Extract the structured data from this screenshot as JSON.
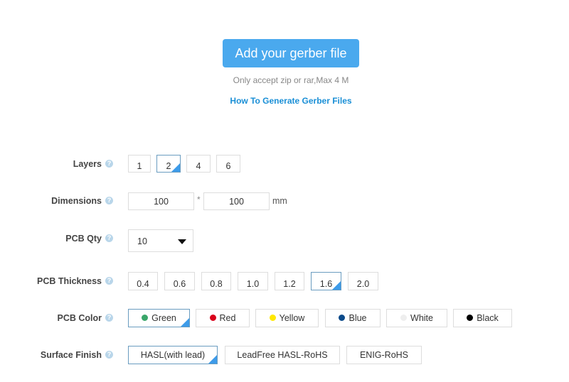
{
  "upload": {
    "button": "Add your gerber file",
    "note": "Only accept zip or rar,Max 4 M",
    "howto_link": "How To Generate Gerber Files"
  },
  "help_icon": "?",
  "layers": {
    "label": "Layers",
    "options": [
      "1",
      "2",
      "4",
      "6"
    ],
    "selected": "2"
  },
  "dimensions": {
    "label": "Dimensions",
    "width": "100",
    "height": "100",
    "separator": "*",
    "unit": "mm"
  },
  "qty": {
    "label": "PCB Qty",
    "value": "10"
  },
  "thickness": {
    "label": "PCB Thickness",
    "options": [
      "0.4",
      "0.6",
      "0.8",
      "1.0",
      "1.2",
      "1.6",
      "2.0"
    ],
    "selected": "1.6"
  },
  "color": {
    "label": "PCB Color",
    "options": [
      {
        "name": "Green",
        "hex": "#3aa66a"
      },
      {
        "name": "Red",
        "hex": "#d9001b"
      },
      {
        "name": "Yellow",
        "hex": "#ffe800"
      },
      {
        "name": "Blue",
        "hex": "#0b4a8a"
      },
      {
        "name": "White",
        "hex": "#eeeeee"
      },
      {
        "name": "Black",
        "hex": "#000000"
      }
    ],
    "selected": "Green"
  },
  "surface": {
    "label": "Surface Finish",
    "options": [
      "HASL(with lead)",
      "LeadFree HASL-RoHS",
      "ENIG-RoHS"
    ],
    "selected": "HASL(with lead)"
  },
  "accent": "#4aa9ee"
}
